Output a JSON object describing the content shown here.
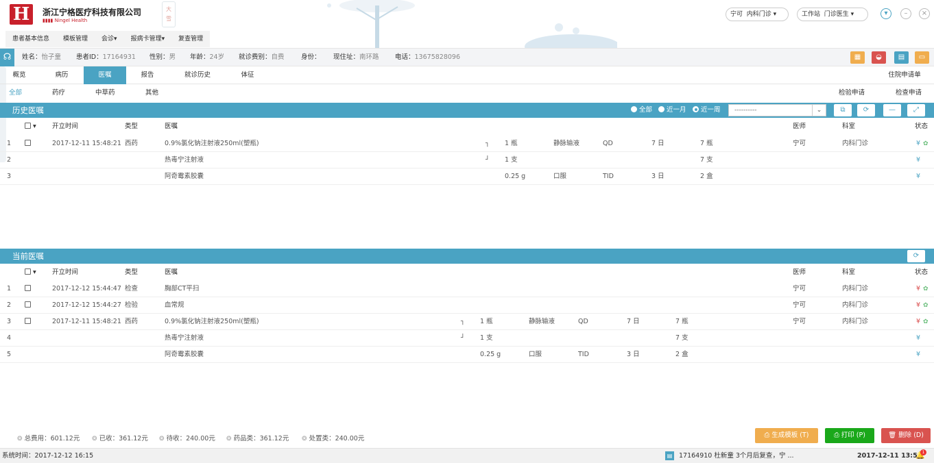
{
  "company": {
    "logo_letter": "H",
    "name": "浙江宁格医疗科技有限公司",
    "sub": "Ningel Health",
    "season": [
      "大",
      "雪"
    ]
  },
  "header_right": {
    "user": "宁可",
    "dept": "内科门诊",
    "workstation_label": "工作站",
    "workstation": "门诊医生"
  },
  "topnav": [
    "患者基本信息",
    "模板管理",
    "会诊▾",
    "报病卡管理▾",
    "复查管理"
  ],
  "patient": {
    "fields": [
      {
        "label": "姓名：",
        "value": "怡子童"
      },
      {
        "label": "患者ID：",
        "value": "17164931"
      },
      {
        "label": "性别：",
        "value": "男"
      },
      {
        "label": "年龄：",
        "value": "24岁"
      },
      {
        "label": "就诊费别：",
        "value": "自费"
      },
      {
        "label": "身份：",
        "value": ""
      },
      {
        "label": "现住址：",
        "value": "南环路"
      },
      {
        "label": "电话：",
        "value": "13675828096"
      }
    ]
  },
  "tabs": [
    "概览",
    "病历",
    "医嘱",
    "报告",
    "就诊历史",
    "体征"
  ],
  "tab_right": "住院申请单",
  "subtabs": [
    "全部",
    "药疗",
    "中草药",
    "其他"
  ],
  "subtab_right": [
    "检验申请",
    "检查申请"
  ],
  "history": {
    "title": "历史医嘱",
    "radios": [
      "全部",
      "近一月",
      "近一周"
    ],
    "select_value": "----------",
    "columns": [
      "开立时间",
      "类型",
      "医嘱",
      "医师",
      "科室",
      "状态"
    ],
    "rows": [
      {
        "no": "1",
        "time": "2017-12-11 15:48:21",
        "type": "西药",
        "order": "0.9%氯化钠注射液250ml(塑瓶)",
        "group": "┐",
        "dose": "1 瓶",
        "route": "静脉输液",
        "freq": "QD",
        "days": "7 日",
        "total": "7 瓶",
        "doctor": "宁可",
        "dept": "内科门诊",
        "status": "¥",
        "status2": "✿",
        "cb": true
      },
      {
        "no": "2",
        "time": "",
        "type": "",
        "order": "热毒宁注射液",
        "group": "┘",
        "dose": "1 支",
        "route": "",
        "freq": "",
        "days": "",
        "total": "7 支",
        "doctor": "",
        "dept": "",
        "status": "¥",
        "status2": "",
        "cb": false
      },
      {
        "no": "3",
        "time": "",
        "type": "",
        "order": "阿奇霉素胶囊",
        "group": "",
        "dose": "0.25 g",
        "route": "口服",
        "freq": "TID",
        "days": "3 日",
        "total": "2 盒",
        "doctor": "",
        "dept": "",
        "status": "¥",
        "status2": "",
        "cb": false
      }
    ]
  },
  "current": {
    "title": "当前医嘱",
    "columns": [
      "开立时间",
      "类型",
      "医嘱",
      "医师",
      "科室",
      "状态"
    ],
    "rows": [
      {
        "no": "1",
        "time": "2017-12-12 15:44:47",
        "type": "检查",
        "order": "胸部CT平扫",
        "group": "",
        "dose": "",
        "route": "",
        "freq": "",
        "days": "",
        "total": "",
        "doctor": "宁可",
        "dept": "内科门诊",
        "status": "¥",
        "status2": "✿",
        "red": true,
        "cb": true
      },
      {
        "no": "2",
        "time": "2017-12-12 15:44:27",
        "type": "检验",
        "order": "血常规",
        "group": "",
        "dose": "",
        "route": "",
        "freq": "",
        "days": "",
        "total": "",
        "doctor": "宁可",
        "dept": "内科门诊",
        "status": "¥",
        "status2": "✿",
        "red": true,
        "cb": true
      },
      {
        "no": "3",
        "time": "2017-12-11 15:48:21",
        "type": "西药",
        "order": "0.9%氯化钠注射液250ml(塑瓶)",
        "group": "┐",
        "dose": "1 瓶",
        "route": "静脉输液",
        "freq": "QD",
        "days": "7 日",
        "total": "7 瓶",
        "doctor": "宁可",
        "dept": "内科门诊",
        "status": "¥",
        "status2": "✿",
        "red": true,
        "cb": true
      },
      {
        "no": "4",
        "time": "",
        "type": "",
        "order": "热毒宁注射液",
        "group": "┘",
        "dose": "1 支",
        "route": "",
        "freq": "",
        "days": "",
        "total": "7 支",
        "doctor": "",
        "dept": "",
        "status": "¥",
        "status2": "",
        "red": false,
        "cb": false
      },
      {
        "no": "5",
        "time": "",
        "type": "",
        "order": "阿奇霉素胶囊",
        "group": "",
        "dose": "0.25 g",
        "route": "口服",
        "freq": "TID",
        "days": "3 日",
        "total": "2 盒",
        "doctor": "",
        "dept": "",
        "status": "¥",
        "status2": "",
        "red": false,
        "cb": false
      }
    ]
  },
  "fees": [
    {
      "label": "总费用：",
      "value": "601.12元"
    },
    {
      "label": "已收：",
      "value": "361.12元"
    },
    {
      "label": "待收：",
      "value": "240.00元"
    },
    {
      "label": "药品类：",
      "value": "361.12元"
    },
    {
      "label": "处置类：",
      "value": "240.00元"
    }
  ],
  "buttons": {
    "template": "生成模板 (T)",
    "print": "打印 (P)",
    "delete": "删除 (D)"
  },
  "colors": {
    "accent": "#4aa3c3",
    "orange": "#f0ad4e",
    "green": "#1aa81a",
    "red": "#d9534f"
  },
  "statusbar": {
    "time_label": "系统时间：2017-12-12 16:15",
    "notice": "17164910 杜新童 3个月后复查，宁 ...",
    "datetime": "2017-12-11 13:54",
    "badge": "1"
  }
}
